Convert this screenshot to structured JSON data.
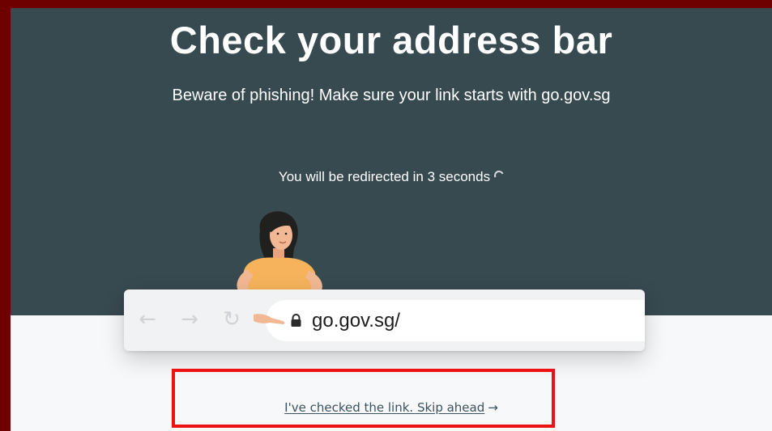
{
  "page": {
    "title": "Check your address bar",
    "subtitle": "Beware of phishing! Make sure your link starts with go.gov.sg",
    "redirect_text": "You will be redirected in 3 seconds",
    "skip_link_label": "I've checked the link. Skip ahead",
    "skip_arrow": "→"
  },
  "browser_bar": {
    "url": "go.gov.sg/",
    "back_icon": "back-arrow-icon",
    "forward_icon": "forward-arrow-icon",
    "reload_icon": "reload-icon",
    "lock_icon": "lock-icon"
  },
  "colors": {
    "hero_background": "#374a50",
    "page_background": "#f7f8f9",
    "highlight_border": "#ee1111",
    "outer_border": "#6e0000",
    "link_color": "#3c5260"
  }
}
